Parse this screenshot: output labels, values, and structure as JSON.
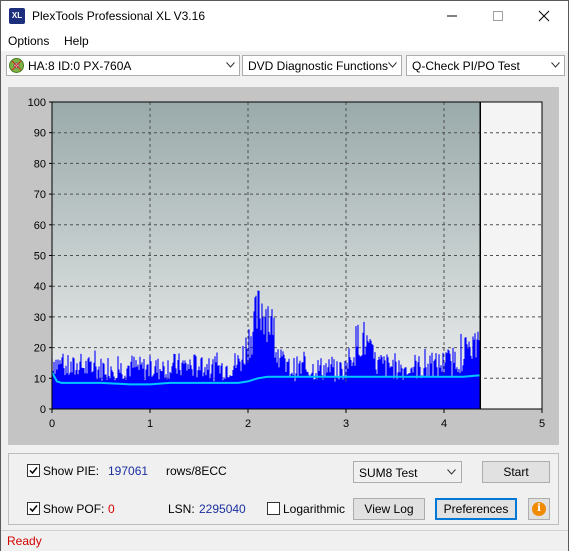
{
  "window": {
    "title": "PlexTools Professional XL V3.16",
    "app_icon_text": "XL"
  },
  "menu": [
    {
      "label": "Options",
      "key": "O"
    },
    {
      "label": "Help",
      "key": "H"
    }
  ],
  "toolbar": {
    "drive": "HA:8 ID:0  PX-760A",
    "function": "DVD Diagnostic Functions",
    "test": "Q-Check PI/PO Test"
  },
  "chart_data": {
    "type": "area",
    "xlim": [
      0,
      5
    ],
    "ylim": [
      0,
      100
    ],
    "x_ticks": [
      0,
      1,
      2,
      3,
      4,
      5
    ],
    "y_ticks": [
      0,
      10,
      20,
      30,
      40,
      50,
      60,
      70,
      80,
      90,
      100
    ],
    "x_tick_labels": [
      "0",
      "1",
      "2",
      "3",
      "4",
      "5"
    ],
    "y_tick_labels": [
      "0",
      "10",
      "20",
      "30",
      "40",
      "50",
      "60",
      "70",
      "80",
      "90",
      "100"
    ],
    "grid": true,
    "data_end_x": 4.37,
    "colors": {
      "pie": "#0000ff",
      "sum8": "#00c8ff",
      "plot_top": "#9aaaaa",
      "plot_bottom": "#f2f2f2"
    },
    "series": [
      {
        "values_kind": "pie_envelope",
        "points": [
          [
            0.0,
            19
          ],
          [
            0.05,
            17
          ],
          [
            0.1,
            16
          ],
          [
            0.2,
            15
          ],
          [
            0.3,
            16
          ],
          [
            0.4,
            15
          ],
          [
            0.5,
            15
          ],
          [
            0.6,
            16
          ],
          [
            0.7,
            15
          ],
          [
            0.8,
            16
          ],
          [
            0.9,
            15
          ],
          [
            1.0,
            15
          ],
          [
            1.1,
            15
          ],
          [
            1.2,
            16
          ],
          [
            1.3,
            16
          ],
          [
            1.4,
            16
          ],
          [
            1.5,
            16
          ],
          [
            1.6,
            15
          ],
          [
            1.7,
            15
          ],
          [
            1.8,
            16
          ],
          [
            1.9,
            17
          ],
          [
            1.95,
            20
          ],
          [
            2.0,
            25
          ],
          [
            2.05,
            30
          ],
          [
            2.1,
            35
          ],
          [
            2.15,
            38
          ],
          [
            2.2,
            36
          ],
          [
            2.25,
            30
          ],
          [
            2.3,
            22
          ],
          [
            2.35,
            17
          ],
          [
            2.4,
            15
          ],
          [
            2.5,
            15
          ],
          [
            2.6,
            15
          ],
          [
            2.7,
            15
          ],
          [
            2.8,
            15
          ],
          [
            2.9,
            14
          ],
          [
            3.0,
            15
          ],
          [
            3.05,
            20
          ],
          [
            3.1,
            24
          ],
          [
            3.15,
            27
          ],
          [
            3.2,
            25
          ],
          [
            3.25,
            20
          ],
          [
            3.3,
            17
          ],
          [
            3.4,
            16
          ],
          [
            3.5,
            16
          ],
          [
            3.6,
            15
          ],
          [
            3.7,
            16
          ],
          [
            3.8,
            15
          ],
          [
            3.9,
            16
          ],
          [
            4.0,
            17
          ],
          [
            4.1,
            18
          ],
          [
            4.2,
            20
          ],
          [
            4.25,
            24
          ],
          [
            4.3,
            23
          ],
          [
            4.37,
            22
          ]
        ]
      },
      {
        "values_kind": "sum8",
        "points": [
          [
            0.0,
            12
          ],
          [
            0.05,
            9
          ],
          [
            0.1,
            8.5
          ],
          [
            0.3,
            8.5
          ],
          [
            0.5,
            8.5
          ],
          [
            0.8,
            8
          ],
          [
            1.0,
            8
          ],
          [
            1.2,
            8.5
          ],
          [
            1.5,
            8.5
          ],
          [
            1.8,
            8.5
          ],
          [
            1.9,
            8.5
          ],
          [
            2.0,
            9
          ],
          [
            2.1,
            10
          ],
          [
            2.2,
            10.5
          ],
          [
            2.4,
            10.5
          ],
          [
            2.6,
            10.5
          ],
          [
            2.8,
            10.5
          ],
          [
            3.0,
            10.5
          ],
          [
            3.2,
            10.5
          ],
          [
            3.5,
            10.5
          ],
          [
            4.0,
            10.5
          ],
          [
            4.2,
            10.5
          ],
          [
            4.37,
            11
          ]
        ]
      }
    ]
  },
  "controls": {
    "show_pie_label": "Show PIE:",
    "show_pie_value": "197061",
    "pie_unit": "rows/8ECC",
    "show_pof_label": "Show POF:",
    "show_pof_value": "0",
    "lsn_label": "LSN:",
    "lsn_value": "2295040",
    "logarithmic_label": "Logarithmic",
    "show_pie_checked": true,
    "show_pof_checked": true,
    "logarithmic_checked": false,
    "test_select": "SUM8 Test",
    "start_label": "Start",
    "view_log_label": "View Log",
    "preferences_label": "Preferences",
    "info_glyph": "i"
  },
  "status": {
    "text": "Ready"
  }
}
